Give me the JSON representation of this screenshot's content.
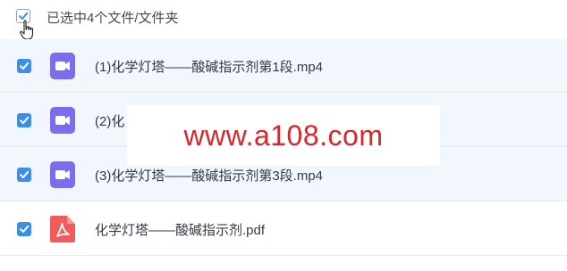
{
  "selection": {
    "label": "已选中4个文件/文件夹"
  },
  "files": [
    {
      "name": "(1)化学灯塔——酸碱指示剂第1段.mp4",
      "icon": "video-file-icon",
      "checked": true
    },
    {
      "name": "(2)化",
      "icon": "video-file-icon",
      "checked": true
    },
    {
      "name": "(3)化学灯塔——酸碱指示剂第3段.mp4",
      "icon": "video-file-icon",
      "checked": true
    },
    {
      "name": "化学灯塔——酸碱指示剂.pdf",
      "icon": "pdf-file-icon",
      "checked": true
    }
  ],
  "watermark": {
    "text": "www.a108.com"
  },
  "colors": {
    "checkbox": "#3a8fe8",
    "video_icon": "#7b6cf0",
    "pdf_icon": "#f25b5b",
    "watermark": "#d8262a",
    "row_bg": "#f2f7fd"
  }
}
